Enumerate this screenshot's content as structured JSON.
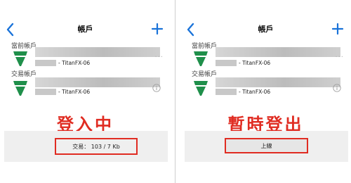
{
  "colors": {
    "accent": "#1a73d9",
    "alert": "#e02c22",
    "logo": "#1f8f4a"
  },
  "left": {
    "title": "帳戶",
    "current_label": "當前帳戶",
    "trading_label": "交易帳戶",
    "current_account": {
      "server": "- TitanFX-06",
      "menu": "···"
    },
    "trading_account": {
      "server": "- TitanFX-06",
      "info_icon": "info-icon"
    },
    "status_big": "登入中",
    "footer_text": "交易： 103 / 7 Kb"
  },
  "right": {
    "title": "帳戶",
    "current_label": "當前帳戶",
    "trading_label": "交易帳戶",
    "current_account": {
      "server": "- TitanFX-06",
      "menu": "···"
    },
    "trading_account": {
      "server": "- TitanFX-06",
      "info_icon": "info-icon"
    },
    "status_big": "暫時登出",
    "footer_button": "上線"
  }
}
